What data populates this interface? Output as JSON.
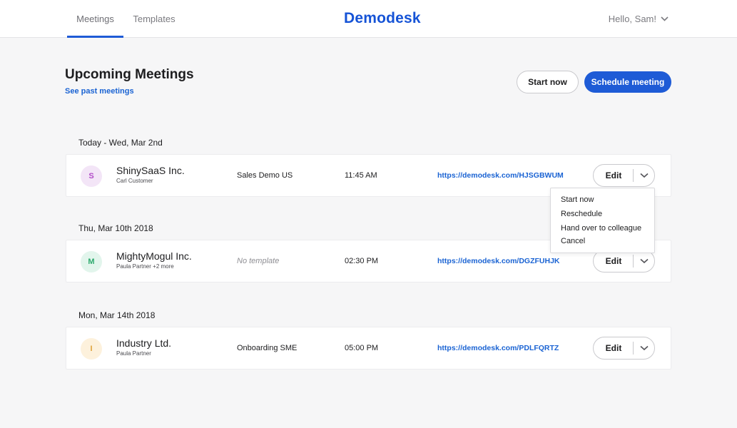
{
  "colors": {
    "accent": "#1e5bd6",
    "link": "#1a63d3",
    "logo": "#1553d6"
  },
  "nav": {
    "tabs": [
      {
        "label": "Meetings",
        "active": true
      },
      {
        "label": "Templates",
        "active": false
      }
    ],
    "logo": "Demodesk",
    "user_greeting": "Hello, Sam!"
  },
  "header": {
    "title": "Upcoming Meetings",
    "past_link": "See past meetings",
    "start_now": "Start now",
    "schedule": "Schedule meeting"
  },
  "groups": [
    {
      "date": "Today - Wed, Mar 2nd",
      "meetings": [
        {
          "avatar_letter": "S",
          "avatar_bg": "#f3e5f7",
          "avatar_fg": "#b24cc8",
          "company": "ShinySaaS Inc.",
          "contact": "Carl Customer",
          "template": "Sales Demo US",
          "template_empty": false,
          "time": "11:45 AM",
          "link": "https://demodesk.com/HJSGBWUM",
          "edit": "Edit"
        }
      ]
    },
    {
      "date": "Thu, Mar 10th 2018",
      "meetings": [
        {
          "avatar_letter": "M",
          "avatar_bg": "#e2f5ec",
          "avatar_fg": "#2eaa6e",
          "company": "MightyMogul Inc.",
          "contact": "Paula Partner +2 more",
          "template": "No template",
          "template_empty": true,
          "time": "02:30 PM",
          "link": "https://demodesk.com/DGZFUHJK",
          "edit": "Edit"
        }
      ]
    },
    {
      "date": "Mon, Mar 14th 2018",
      "meetings": [
        {
          "avatar_letter": "I",
          "avatar_bg": "#fdf1dc",
          "avatar_fg": "#e0a23a",
          "company": "Industry Ltd.",
          "contact": "Paula Partner",
          "template": "Onboarding SME",
          "template_empty": false,
          "time": "05:00 PM",
          "link": "https://demodesk.com/PDLFQRTZ",
          "edit": "Edit"
        }
      ]
    }
  ],
  "dropdown": {
    "items": [
      "Start now",
      "Reschedule",
      "Hand over to colleague",
      "Cancel"
    ]
  }
}
